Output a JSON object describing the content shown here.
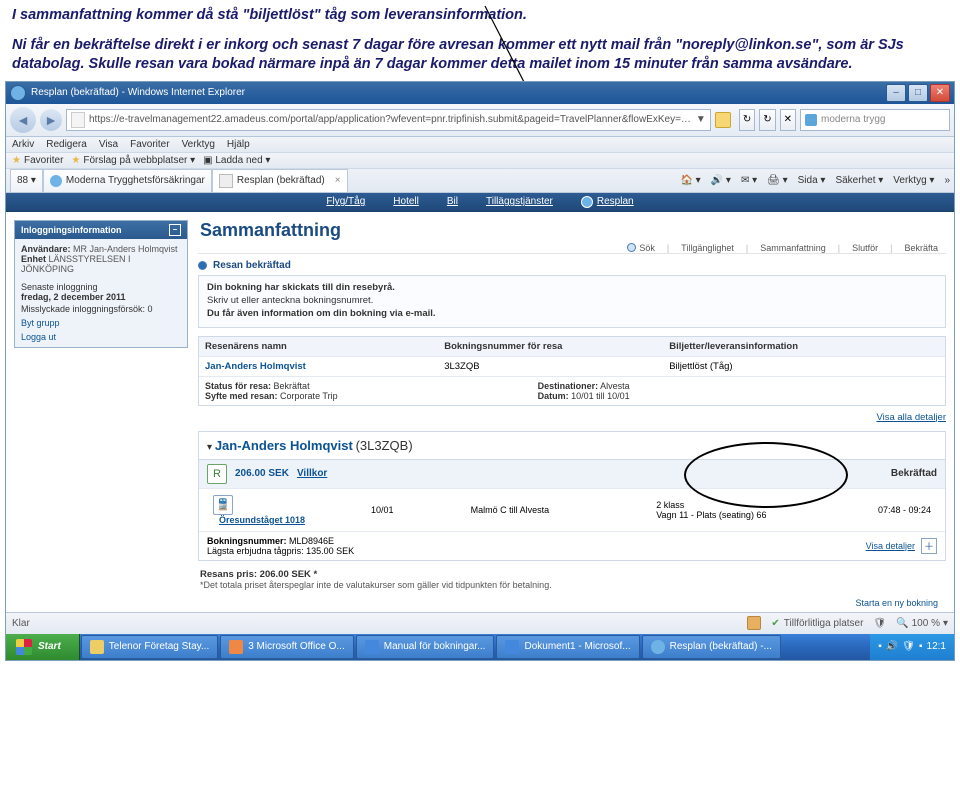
{
  "doc": {
    "p1": "I sammanfattning kommer då stå \"biljettlöst\" tåg som leveransinformation.",
    "p2": "Ni får en bekräftelse direkt i er inkorg och senast 7 dagar före avresan kommer ett nytt mail från \"noreply@linkon.se\", som är SJs databolag. Skulle resan vara bokad närmare inpå än 7 dagar kommer detta mailet inom 15 minuter från samma avsändare."
  },
  "browser": {
    "title": "Resplan (bekräftad) - Windows Internet Explorer",
    "url": "https://e-travelmanagement22.amadeus.com/portal/app/application?wfevent=pnr.tripfinish.submit&pageid=TravelPlanner&flowExKey=ew&portletid=T",
    "refresh": "↻",
    "searchPlaceholder": "moderna trygg",
    "menu": [
      "Arkiv",
      "Redigera",
      "Visa",
      "Favoriter",
      "Verktyg",
      "Hjälp"
    ],
    "favLabel": "Favoriter",
    "suggest": "Förslag på webbplatser ▾",
    "ladda": "▣ Ladda ned ▾",
    "tabPrefix": "88 ▾",
    "tabs": [
      {
        "label": "Moderna Trygghetsförsäkringar"
      },
      {
        "label": "Resplan (bekräftad)"
      }
    ],
    "tools": [
      "🏠 ▾",
      "🔊 ▾",
      "✉ ▾",
      "🖨 ▾",
      "Sida ▾",
      "Säkerhet ▾",
      "Verktyg ▾",
      "»"
    ],
    "bluebar": [
      "Flyg/Tåg",
      "Hotell",
      "Bil",
      "Tilläggstjänster"
    ],
    "resplan": "Resplan"
  },
  "side": {
    "title": "Inloggningsinformation",
    "userLabel": "Användare:",
    "user": "MR Jan-Anders Holmqvist",
    "unitLabel": "Enhet",
    "unit": "LÄNSSTYRELSEN I JÖNKÖPING",
    "lastLoginLabel": "Senaste inloggning",
    "lastLogin": "fredag, 2 december 2011",
    "failLabel": "Misslyckade inloggningsförsök: 0",
    "link1": "Byt grupp",
    "link2": "Logga ut"
  },
  "main": {
    "heading": "Sammanfattning",
    "crumb": {
      "sok": "Sök",
      "sep": "|",
      "till": "Tillgänglighet",
      "samman": "Sammanfattning",
      "slutfor": "Slutför",
      "bekr": "Bekräfta"
    },
    "sectionTitle": "Resan bekräftad",
    "info": {
      "l1": "Din bokning har skickats till din resebyrå.",
      "l2": "Skriv ut eller anteckna bokningsnumret.",
      "l3": "Du får även information om din bokning via e-mail."
    },
    "table": {
      "h1": "Resenärens namn",
      "h2": "Bokningsnummer för resa",
      "h3": "Biljetter/leveransinformation",
      "name": "Jan-Anders Holmqvist",
      "pnr": "3L3ZQB",
      "delivery": "Biljettlöst (Tåg)",
      "statusLabel": "Status för resa:",
      "statusVal": "Bekräftat",
      "purposeLabel": "Syfte med resan:",
      "purposeVal": "Corporate Trip",
      "destLabel": "Destinationer:",
      "destVal": "Alvesta",
      "dateLabel": "Datum:",
      "dateVal": "10/01 till 10/01"
    },
    "visaAlla": "Visa alla detaljer",
    "pnr": {
      "name": "Jan-Anders Holmqvist",
      "code": "(3L3ZQB)",
      "price": "206.00 SEK",
      "villkor": "Villkor",
      "bekr": "Bekräftad",
      "segName": "Öresundståget 1018",
      "segDate": "10/01",
      "segRoute": "Malmö C till Alvesta",
      "segClass": "2 klass",
      "segSeat": "Vagn 11 - Plats (seating) 66",
      "segTime": "07:48 - 09:24",
      "bookingLabel": "Bokningsnummer:",
      "bookingVal": "MLD8946E",
      "lowestLabel": "Lägsta erbjudna tågpris:",
      "lowestVal": "135.00 SEK",
      "visaDet": "Visa detaljer",
      "plus": "＋"
    },
    "total": {
      "l1label": "Resans pris:",
      "l1val": "206.00 SEK *",
      "l2": "*Det totala priset återspeglar inte de valutakurser som gäller vid tidpunkten för betalning."
    },
    "starta": "Starta en ny bokning"
  },
  "statusbar": {
    "klar": "Klar",
    "trusted": "Tillförlitliga platser",
    "zoom": "100 %"
  },
  "taskbar": {
    "start": "Start",
    "items": [
      "Telenor Företag Stay...",
      "3 Microsoft Office O...",
      "Manual för bokningar...",
      "Dokument1 - Microsof...",
      "Resplan (bekräftad) -..."
    ],
    "time": "12:1"
  }
}
